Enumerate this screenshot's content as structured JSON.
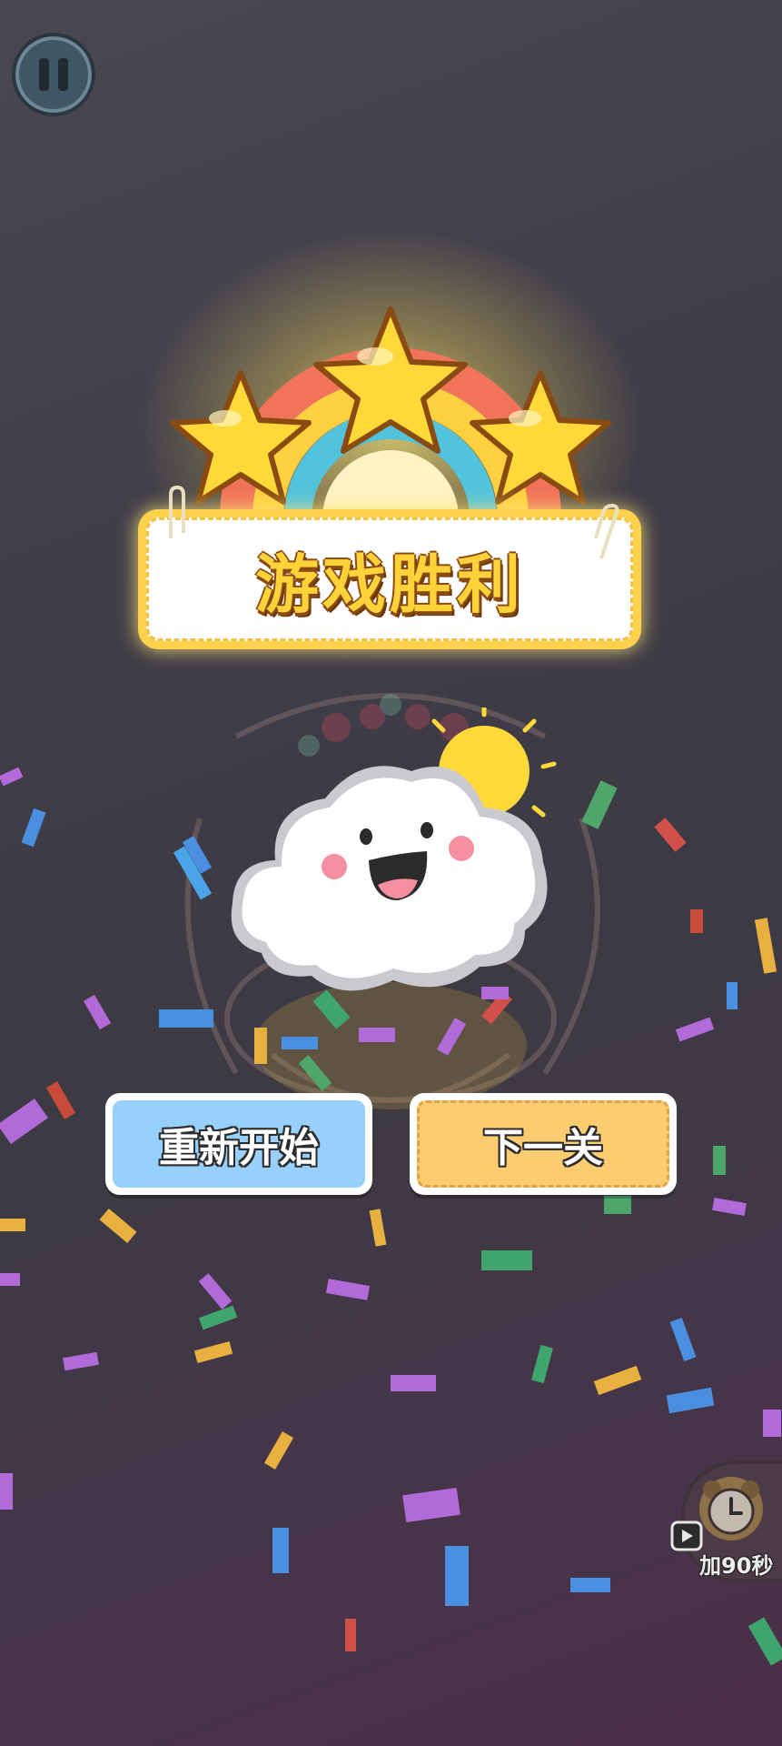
{
  "hud": {
    "pause_icon": "pause-icon"
  },
  "result": {
    "title": "游戏胜利",
    "stars_earned": 3,
    "stars_total": 3,
    "star_color": "#ffd83a",
    "mascot": "smiling-cloud-with-sun"
  },
  "buttons": {
    "restart_label": "重新开始",
    "next_label": "下一关",
    "restart_color": "#96d0fb",
    "next_color": "#fbcd70"
  },
  "bonus": {
    "label": "加90秒",
    "icon": "alarm-clock-icon",
    "ad_icon": "video-play-icon"
  }
}
